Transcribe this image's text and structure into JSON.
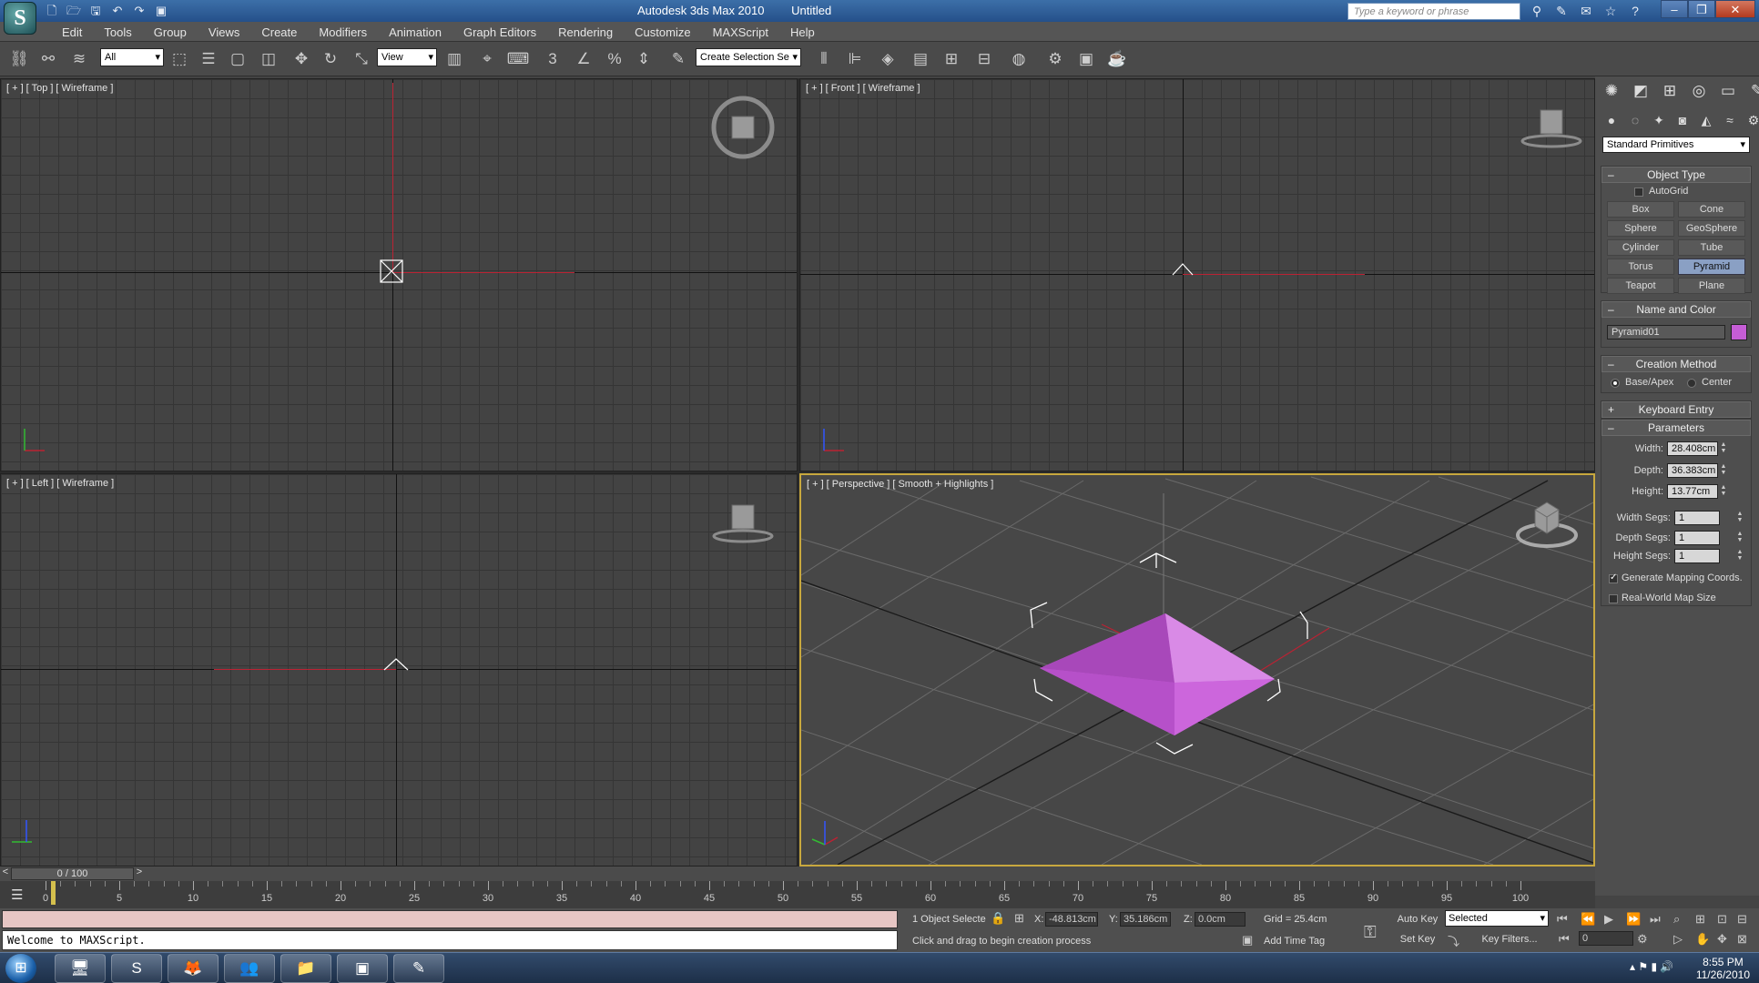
{
  "titlebar": {
    "app_name": "Autodesk 3ds Max 2010",
    "doc_name": "Untitled",
    "search_placeholder": "Type a keyword or phrase"
  },
  "menu": [
    "Edit",
    "Tools",
    "Group",
    "Views",
    "Create",
    "Modifiers",
    "Animation",
    "Graph Editors",
    "Rendering",
    "Customize",
    "MAXScript",
    "Help"
  ],
  "toolbar": {
    "selection_filter": "All",
    "ref_coord": "View",
    "named_selection": "Create Selection Se"
  },
  "viewports": {
    "top": {
      "plus": "[ + ]",
      "name": "[ Top ]",
      "mode": "[ Wireframe ]"
    },
    "front": {
      "plus": "[ + ]",
      "name": "[ Front ]",
      "mode": "[ Wireframe ]"
    },
    "left": {
      "plus": "[ + ]",
      "name": "[ Left ]",
      "mode": "[ Wireframe ]"
    },
    "perspective": {
      "plus": "[ + ]",
      "name": "[ Perspective ]",
      "mode": "[ Smooth + Highlights ]"
    },
    "object_color": "#c65dd6"
  },
  "command_panel": {
    "category": "Standard Primitives",
    "object_type": {
      "title": "Object Type",
      "autogrid": "AutoGrid",
      "buttons": [
        "Box",
        "Cone",
        "Sphere",
        "GeoSphere",
        "Cylinder",
        "Tube",
        "Torus",
        "Pyramid",
        "Teapot",
        "Plane"
      ],
      "active": "Pyramid"
    },
    "name_color": {
      "title": "Name and Color",
      "name": "Pyramid01",
      "color": "#c65dd6"
    },
    "creation_method": {
      "title": "Creation Method",
      "opt1": "Base/Apex",
      "opt2": "Center"
    },
    "keyboard_entry": {
      "title": "Keyboard Entry"
    },
    "parameters": {
      "title": "Parameters",
      "width_label": "Width:",
      "width": "28.408cm",
      "depth_label": "Depth:",
      "depth": "36.383cm",
      "height_label": "Height:",
      "height": "13.77cm",
      "wsegs_label": "Width Segs:",
      "wsegs": "1",
      "dsegs_label": "Depth Segs:",
      "dsegs": "1",
      "hsegs_label": "Height Segs:",
      "hsegs": "1",
      "gen_mapping": "Generate Mapping Coords.",
      "real_world": "Real-World Map Size"
    }
  },
  "timeline": {
    "frame_display": "0 / 100",
    "prev": "<",
    "next": ">",
    "ticks": [
      "0",
      "5",
      "10",
      "15",
      "20",
      "25",
      "30",
      "35",
      "40",
      "45",
      "50",
      "55",
      "60",
      "65",
      "70",
      "75",
      "80",
      "85",
      "90",
      "95",
      "100"
    ]
  },
  "status": {
    "maxscript_text": "Welcome to MAXScript.",
    "selection": "1 Object Selecte",
    "x_label": "X:",
    "x": "-48.813cm",
    "y_label": "Y:",
    "y": "35.186cm",
    "z_label": "Z:",
    "z": "0.0cm",
    "grid": "Grid = 25.4cm",
    "prompt": "Click and drag to begin creation process",
    "add_time_tag": "Add Time Tag",
    "auto_key": "Auto Key",
    "set_key": "Set Key",
    "selected_dropdown": "Selected",
    "key_filters": "Key Filters...",
    "frame": "0"
  },
  "taskbar": {
    "time": "8:55 PM",
    "date": "11/26/2010"
  }
}
